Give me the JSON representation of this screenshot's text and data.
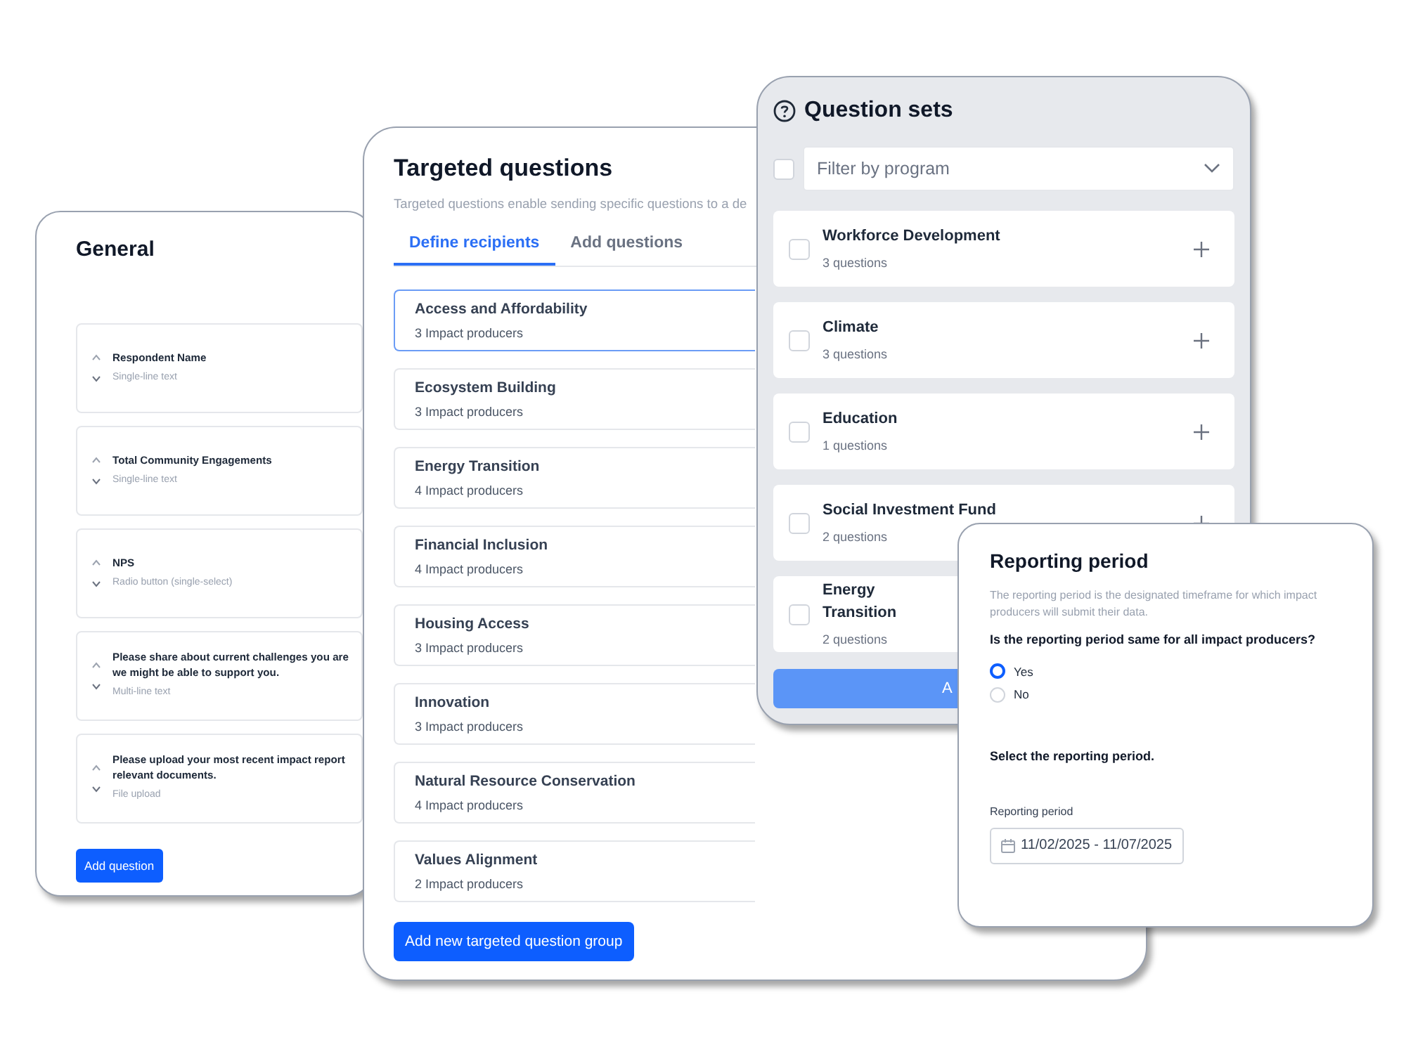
{
  "general": {
    "title": "General",
    "questions": [
      {
        "title": "Respondent Name",
        "type": "Single-line text"
      },
      {
        "title": "Total Community Engagements",
        "type": "Single-line text"
      },
      {
        "title": "NPS",
        "type": "Radio button (single-select)"
      },
      {
        "title": "Please share about current challenges you are we might be able to support you.",
        "type": "Multi-line text"
      },
      {
        "title": "Please upload your most recent impact report relevant documents.",
        "type": "File upload"
      }
    ],
    "button": "Add question"
  },
  "targeted": {
    "title": "Targeted questions",
    "description": "Targeted questions enable sending specific questions to a de",
    "tabs": [
      {
        "label": "Define recipients",
        "selected": true
      },
      {
        "label": "Add questions",
        "selected": false
      }
    ],
    "groups": [
      {
        "name": "Access and Affordability",
        "count": "3 Impact producers",
        "selected": true
      },
      {
        "name": "Ecosystem Building",
        "count": "3 Impact producers",
        "selected": false
      },
      {
        "name": "Energy Transition",
        "count": "4 Impact producers",
        "selected": false
      },
      {
        "name": "Financial Inclusion",
        "count": "4 Impact producers",
        "selected": false
      },
      {
        "name": "Housing Access",
        "count": "3 Impact producers",
        "selected": false
      },
      {
        "name": "Innovation",
        "count": "3 Impact producers",
        "selected": false
      },
      {
        "name": "Natural Resource Conservation",
        "count": "4 Impact producers",
        "selected": false
      },
      {
        "name": "Values Alignment",
        "count": "2 Impact producers",
        "selected": false
      }
    ],
    "button": "Add new targeted question group"
  },
  "question_sets": {
    "title": "Question sets",
    "select_all": {
      "checked": false
    },
    "filter": {
      "placeholder": "Filter by program"
    },
    "sets": [
      {
        "name": "Workforce Development",
        "count": "3 questions",
        "checked": false
      },
      {
        "name": "Climate",
        "count": "3 questions",
        "checked": false
      },
      {
        "name": "Education",
        "count": "1 questions",
        "checked": false
      },
      {
        "name": "Social Investment Fund",
        "count": "2 questions",
        "checked": false
      },
      {
        "name": "Energy Transition",
        "count": "2 questions",
        "checked": false
      }
    ],
    "button": "A"
  },
  "reporting": {
    "title": "Reporting period",
    "description": "The reporting period is the designated timeframe for which impact producers will submit their data.",
    "question": "Is the reporting period same for all impact producers?",
    "options": [
      {
        "label": "Yes",
        "selected": true
      },
      {
        "label": "No",
        "selected": false
      }
    ],
    "select_label": "Select the reporting period.",
    "field_label": "Reporting period",
    "field_value": "11/02/2025 - 11/07/2025"
  }
}
